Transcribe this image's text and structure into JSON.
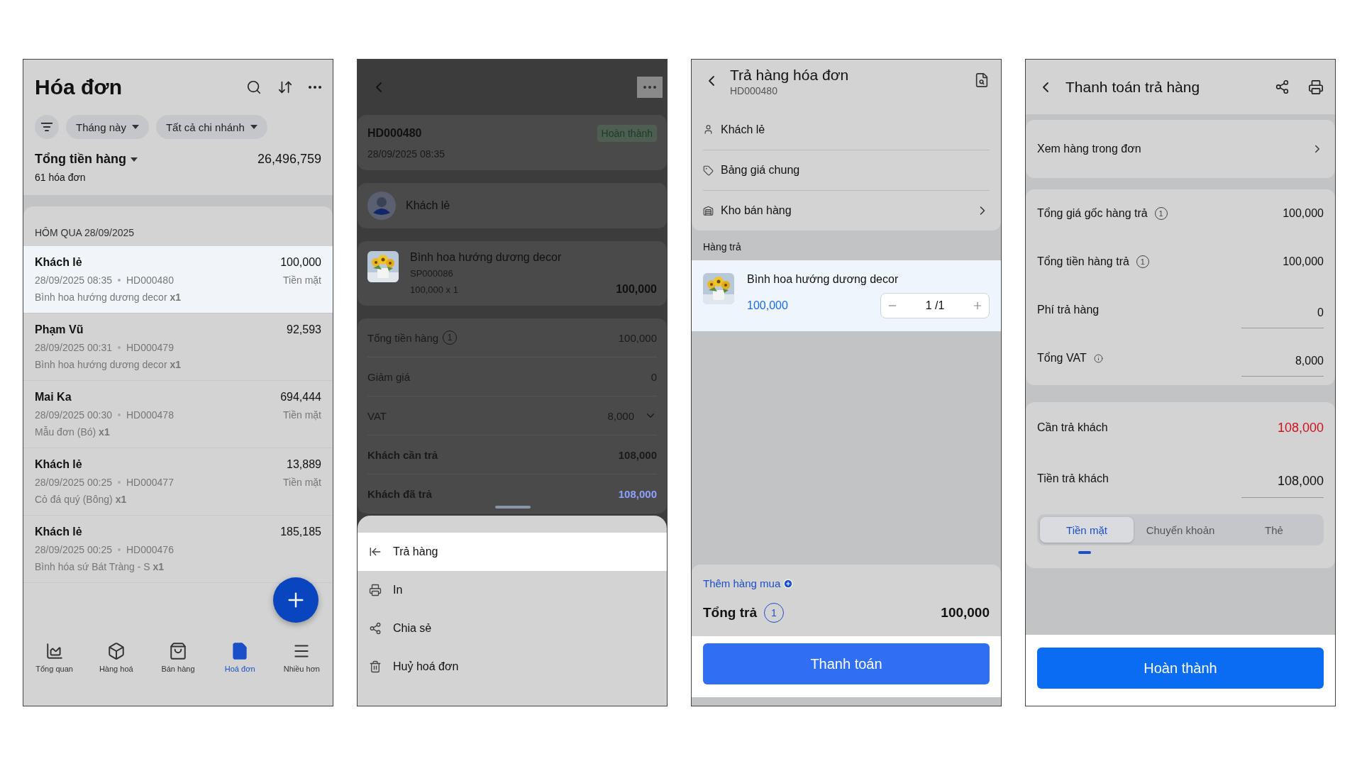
{
  "screens": [
    {
      "kind": "invoice_list",
      "title": "Hóa đơn",
      "filters": [
        {
          "label": "Tháng này"
        },
        {
          "label": "Tất cả chi nhánh"
        }
      ],
      "summary": {
        "label": "Tổng tiền hàng",
        "value": "26,496,759",
        "count": "61 hóa đơn"
      },
      "section_label": "HÔM QUA 28/09/2025",
      "invoices": [
        {
          "customer": "Khách lẻ",
          "amount": "100,000",
          "datetime": "28/09/2025 08:35",
          "code": "HD000480",
          "payment": "Tiền mặt",
          "item": "Bình hoa hướng dương decor **x1**",
          "selected": true
        },
        {
          "customer": "Phạm Vũ",
          "amount": "92,593",
          "datetime": "28/09/2025 00:31",
          "code": "HD000479",
          "item": "Bình hoa hướng dương decor **x1**",
          "selected": false
        },
        {
          "customer": "Mai Ka",
          "amount": "694,444",
          "datetime": "28/09/2025 00:30",
          "code": "HD000478",
          "payment": "Tiền mặt",
          "item": "Mẫu đơn (Bó) **x1**",
          "selected": false
        },
        {
          "customer": "Khách lẻ",
          "amount": "13,889",
          "datetime": "28/09/2025 00:25",
          "code": "HD000477",
          "payment": "Tiền mặt",
          "item": "Cỏ đá quý (Bông) **x1**",
          "selected": false
        },
        {
          "customer": "Khách lẻ",
          "amount": "185,185",
          "datetime": "28/09/2025 00:25",
          "code": "HD000476",
          "item": "Bình hóa sứ Bát Tràng - S **x1**",
          "selected": false
        }
      ],
      "nav": [
        {
          "label": "Tổng quan",
          "selected": false
        },
        {
          "label": "Hàng hoá",
          "selected": false
        },
        {
          "label": "Bán hàng",
          "selected": false
        },
        {
          "label": "Hoá đơn",
          "selected": true
        },
        {
          "label": "Nhiều hơn",
          "selected": false
        }
      ]
    },
    {
      "kind": "invoice_detail",
      "code": "HD000480",
      "datetime": "28/09/2025 08:35",
      "status": "Hoàn thành",
      "customer": "Khách lẻ",
      "product": {
        "name": "Bình hoa hướng dương decor",
        "sku": "SP000086",
        "price_qty": "100,000 x 1",
        "total": "100,000"
      },
      "totals": [
        {
          "label": "Tổng tiền hàng",
          "badge": "1",
          "value": "100,000",
          "kind": "plain"
        },
        {
          "label": "Giảm giá",
          "value": "0",
          "kind": "plain"
        },
        {
          "label": "VAT",
          "value": "8,000",
          "kind": "expandable"
        },
        {
          "label": "Khách cần trả",
          "value": "108,000",
          "kind": "strong"
        },
        {
          "label": "Khách đã trả",
          "value": "108,000",
          "kind": "paid"
        }
      ],
      "sheet": [
        {
          "label": "Trả hàng",
          "selected": true
        },
        {
          "label": "In",
          "selected": false
        },
        {
          "label": "Chia sẻ",
          "selected": false
        },
        {
          "label": "Huỷ hoá đơn",
          "selected": false
        }
      ]
    },
    {
      "kind": "return",
      "title": "Trả hàng hóa đơn",
      "code": "HD000480",
      "info": [
        {
          "label": "Khách lẻ",
          "chevron": false
        },
        {
          "label": "Bảng giá chung",
          "chevron": false
        },
        {
          "label": "Kho bán hàng",
          "chevron": true
        }
      ],
      "section_label": "Hàng trả",
      "items": [
        {
          "name": "Bình hoa hướng dương decor",
          "price": "100,000",
          "qty": "1 /1"
        }
      ],
      "add_label": "Thêm hàng mua",
      "total_label": "Tổng trả",
      "total_count": "1",
      "total_value": "100,000",
      "button": "Thanh toán"
    },
    {
      "kind": "payment",
      "title": "Thanh toán trả hàng",
      "view_row": "Xem hàng trong đơn",
      "rows": [
        {
          "label": "Tổng giá gốc hàng trả",
          "badge": "1",
          "value": "100,000",
          "kind": "text"
        },
        {
          "label": "Tổng tiền hàng trả",
          "badge": "1",
          "value": "100,000",
          "kind": "text"
        },
        {
          "label": "Phí trả hàng",
          "value": "0",
          "kind": "input"
        },
        {
          "label": "Tổng VAT",
          "value": "8,000",
          "kind": "input_info"
        }
      ],
      "due": {
        "label": "Cần trả khách",
        "value": "108,000"
      },
      "paid": {
        "label": "Tiền trả khách",
        "value": "108,000"
      },
      "methods": [
        {
          "label": "Tiền mặt",
          "selected": true
        },
        {
          "label": "Chuyển khoản",
          "selected": false
        },
        {
          "label": "Thẻ",
          "selected": false
        }
      ],
      "button": "Hoàn thành"
    }
  ]
}
